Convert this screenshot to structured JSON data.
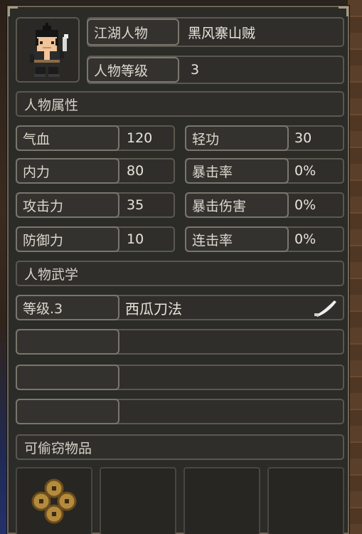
{
  "character": {
    "name_label": "江湖人物",
    "name_value": "黑风寨山贼",
    "level_label": "人物等级",
    "level_value": "3"
  },
  "attributes": {
    "section_title": "人物属性",
    "rows": [
      {
        "left_label": "气血",
        "left_value": "120",
        "right_label": "轻功",
        "right_value": "30"
      },
      {
        "left_label": "内力",
        "left_value": "80",
        "right_label": "暴击率",
        "right_value": "0%"
      },
      {
        "left_label": "攻击力",
        "left_value": "35",
        "right_label": "暴击伤害",
        "right_value": "0%"
      },
      {
        "left_label": "防御力",
        "left_value": "10",
        "right_label": "连击率",
        "right_value": "0%"
      }
    ]
  },
  "martial_arts": {
    "section_title": "人物武学",
    "skills": [
      {
        "level": "等级.3",
        "name": "西瓜刀法",
        "icon": "blade-icon"
      },
      {
        "level": "",
        "name": ""
      },
      {
        "level": "",
        "name": ""
      },
      {
        "level": "",
        "name": ""
      }
    ]
  },
  "stealable": {
    "section_title": "可偷窃物品",
    "items": [
      {
        "icon": "copper-coins-icon"
      },
      {
        "icon": ""
      },
      {
        "icon": ""
      },
      {
        "icon": ""
      }
    ]
  },
  "colors": {
    "panel_bg": "#2b2b27",
    "border": "#5c5850",
    "text": "#e6e0d4"
  }
}
